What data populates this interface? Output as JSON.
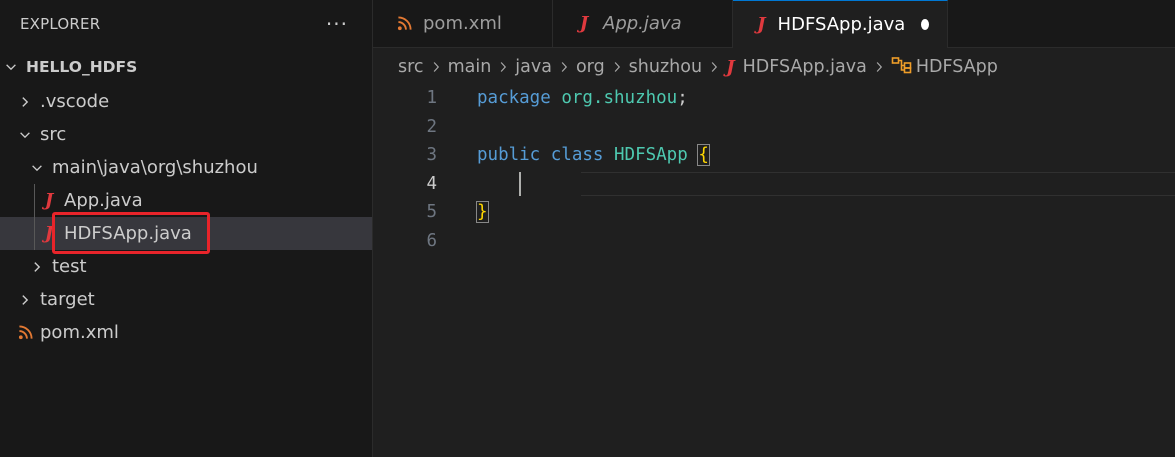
{
  "explorer": {
    "title": "EXPLORER",
    "more": "···"
  },
  "tree": {
    "root": "HELLO_HDFS",
    "vscode": ".vscode",
    "src": "src",
    "main": "main\\java\\org\\shuzhou",
    "app": "App.java",
    "hdfsapp": "HDFSApp.java",
    "test": "test",
    "target": "target",
    "pom": "pom.xml"
  },
  "tabs": [
    {
      "label": "pom.xml"
    },
    {
      "label": "App.java"
    },
    {
      "label": "HDFSApp.java"
    }
  ],
  "breadcrumb": {
    "src": "src",
    "main": "main",
    "java": "java",
    "org": "org",
    "shuzhou": "shuzhou",
    "file": "HDFSApp.java",
    "symbol": "HDFSApp"
  },
  "editor": {
    "line_numbers": [
      "1",
      "2",
      "3",
      "4",
      "5",
      "6"
    ],
    "kw_package": "package",
    "pkg_name": "org.shuzhou",
    "semicolon": ";",
    "kw_public": "public",
    "kw_class": "class",
    "class_name": "HDFSApp",
    "open_brace": "{",
    "close_brace": "}"
  },
  "colors": {
    "java_icon": "#e0393e",
    "xml_icon": "#e37933",
    "highlight_box": "#e8242a",
    "symbol_class_icon": "#ee9d28"
  },
  "icons": {
    "java": "java-j-icon",
    "xml": "rss-icon",
    "chevron": "chevron-icon",
    "class": "symbol-class-icon"
  }
}
